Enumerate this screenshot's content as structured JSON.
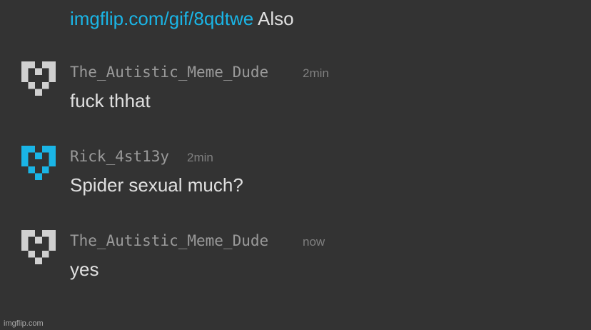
{
  "top_line": {
    "link_text": "imgflip.com/gif/8qdtwe",
    "trailing_text": " Also"
  },
  "colors": {
    "background": "#333333",
    "link": "#1ab5e6",
    "avatar_default": "#d0d0d0",
    "avatar_highlight": "#1ab5e6",
    "text": "#e0e0e0",
    "username": "#9a9a9a",
    "timestamp": "#808080"
  },
  "comments": [
    {
      "username": "The_Autistic_Meme_Dude",
      "time": "2min",
      "text": "fuck thhat",
      "avatar_icon": "pixel-heart-icon",
      "avatar_color": "#d0d0d0"
    },
    {
      "username": "Rick_4st13y",
      "time": "2min",
      "text": "Spider sexual much?",
      "avatar_icon": "pixel-heart-icon",
      "avatar_color": "#1ab5e6"
    },
    {
      "username": "The_Autistic_Meme_Dude",
      "time": "now",
      "text": "yes",
      "avatar_icon": "pixel-heart-icon",
      "avatar_color": "#d0d0d0"
    }
  ],
  "watermark": "imgflip.com"
}
